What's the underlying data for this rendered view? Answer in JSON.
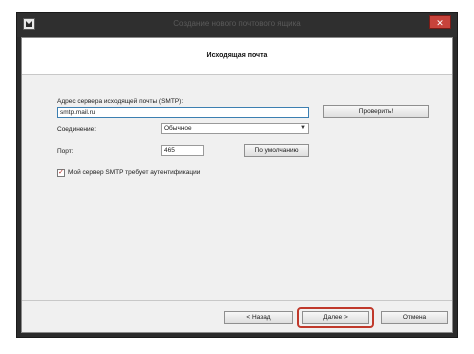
{
  "window": {
    "title": "Создание нового почтового ящика",
    "close_symbol": "✕"
  },
  "header": {
    "title": "Исходящая почта"
  },
  "form": {
    "smtp_label": "Адрес сервера исходящей почты (SMTP):",
    "smtp_value": "smtp.mail.ru",
    "check_button": "Проверить!",
    "connection_label": "Соединение:",
    "connection_value": "Обычное",
    "port_label": "Порт:",
    "port_value": "465",
    "default_button": "По умолчанию",
    "auth_checkbox_label": "Мой сервер SMTP требует аутентификации",
    "auth_checked": true
  },
  "footer": {
    "back_button": "< Назад",
    "next_button": "Далее >",
    "cancel_button": "Отмена"
  },
  "icons": {
    "app": "mail-app-icon",
    "close": "close-icon",
    "dropdown": "chevron-down-icon",
    "checkbox": "checkmark-icon"
  },
  "colors": {
    "highlight": "#c0392b",
    "close_button": "#c7433b",
    "focus_border": "#3c7fb1"
  }
}
